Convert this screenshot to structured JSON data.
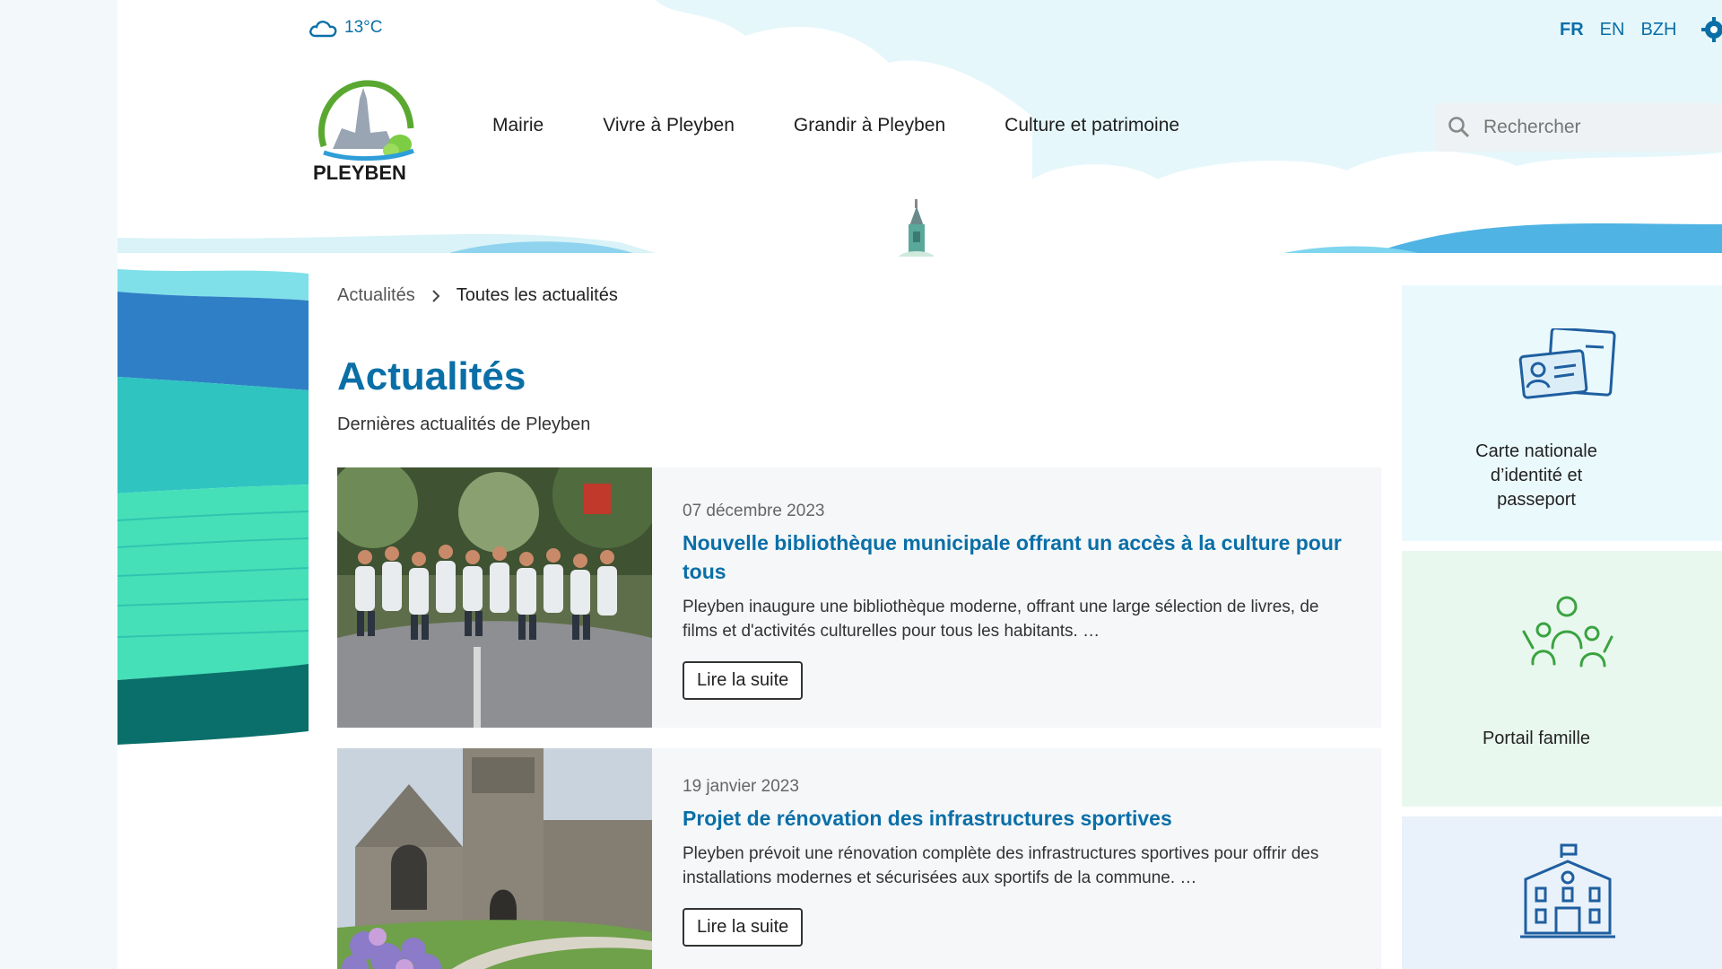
{
  "weather": {
    "icon": "cloud-icon",
    "temperature": "13°C"
  },
  "languages": [
    {
      "label": "FR",
      "active": true
    },
    {
      "label": "EN",
      "active": false
    },
    {
      "label": "BZH",
      "active": false
    }
  ],
  "logo": {
    "text": "PLEYBEN"
  },
  "nav": [
    "Mairie",
    "Vivre à Pleyben",
    "Grandir à Pleyben",
    "Culture et patrimoine"
  ],
  "search": {
    "placeholder": "Rechercher"
  },
  "breadcrumb": {
    "parent": "Actualités",
    "current": "Toutes les actualités"
  },
  "page": {
    "title": "Actualités",
    "subtitle": "Dernières actualités de Pleyben"
  },
  "news": [
    {
      "date": "07 décembre 2023",
      "title": "Nouvelle bibliothèque municipale offrant un accès à la culture pour tous",
      "excerpt": "Pleyben inaugure une bibliothèque moderne, offrant une large sélection de livres, de films et d'activités culturelles pour tous les habitants. …",
      "button": "Lire la suite"
    },
    {
      "date": "19 janvier 2023",
      "title": "Projet de rénovation des infrastructures sportives",
      "excerpt": "Pleyben prévoit une rénovation complète des infrastructures sportives pour offrir des installations modernes et sécurisées aux sportifs de la commune. …",
      "button": "Lire la suite"
    }
  ],
  "quick_links": [
    {
      "label": "Carte nationale d’identité  et passeport",
      "icon": "id-card-icon"
    },
    {
      "label": "Portail famille",
      "icon": "family-icon"
    },
    {
      "label": "",
      "icon": "town-hall-icon"
    }
  ],
  "colors": {
    "primary": "#0a6fa7",
    "teal": "#3ddbb5",
    "sky": "#d9f3f8"
  }
}
